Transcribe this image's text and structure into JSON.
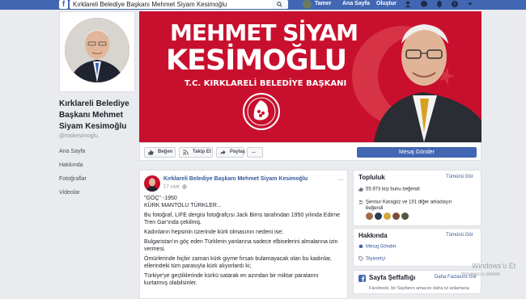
{
  "topbar": {
    "logo": "f",
    "search_value": "Kırklareli Belediye Başkanı Mehmet Siyam Kesimoğlu",
    "user_name": "Tamer",
    "home_label": "Ana Sayfa",
    "create_label": "Oluştur"
  },
  "sidebar": {
    "page_name": "Kırklareli Belediye Başkanı Mehmet Siyam Kesimoğlu",
    "handle": "@mskesimoglu",
    "items": [
      {
        "label": "Ana Sayfa"
      },
      {
        "label": "Hakkında"
      },
      {
        "label": "Fotoğraflar"
      },
      {
        "label": "Videolar"
      }
    ]
  },
  "cover": {
    "line1": "MEHMET SİYAM",
    "line2": "KESİMOĞLU",
    "subtitle": "T.C. KIRKLARELİ BELEDİYE BAŞKANI"
  },
  "actions": {
    "like": "Beğen",
    "follow": "Takip Et",
    "share": "Paylaş",
    "more": "...",
    "message": "Mesaj Gönder"
  },
  "post": {
    "author": "Kırklareli Belediye Başkanı Mehmet Siyam Kesimoğlu",
    "time": "17 saat",
    "menu": "...",
    "paragraphs": [
      "\"GÖÇ\" -1950",
      "KÜRK MANTOLU TÜRKLER...",
      "Bu fotoğraf, LIFE dergisi fotoğrafçısı Jack Birns tarafından 1950 yılında Edirne Tren Gar'ında çekilmiş.",
      "Kadınların hepsinin üzerinde kürk olmasının nedeni ise;",
      "Bulgaristan'ın göç eden Türklerin yanlarına sadece elbiselerini almalarına izin vermesi.",
      "Ömürlerinde hiçbir zaman kürk giyme fırsatı bulamayacak olan bu kadınlar, ellerindeki tüm parasıyla kürk alıyorlardı ki;",
      "Türkiye'ye geçtiklerinde kürkü satarak en azından bir miktar paralarını kurtarmış olabilsinler."
    ]
  },
  "community": {
    "title": "Topluluk",
    "see_all": "Tümünü Gör",
    "likes": "55.973 kişi bunu beğendi",
    "friends_line1": "Şennur Karagöz ve 191 diğer arkadaşın",
    "friends_line2": "beğendi"
  },
  "about": {
    "title": "Hakkında",
    "see_all": "Tümünü Gör",
    "message": "Mesaj Gönder",
    "politician": "Siyasetçi"
  },
  "transparency": {
    "title": "Sayfa Şeffaflığı",
    "more_info": "Daha Fazlasını Gör",
    "text": "Facebook, bir Sayfanın amacını daha iyi anlamana"
  },
  "watermark": {
    "line1": "Windows'u Et",
    "line2": "Windows'u etkinle"
  },
  "colors": {
    "brand": "#4267b2",
    "cover_red": "#c8102e",
    "link": "#365899"
  }
}
